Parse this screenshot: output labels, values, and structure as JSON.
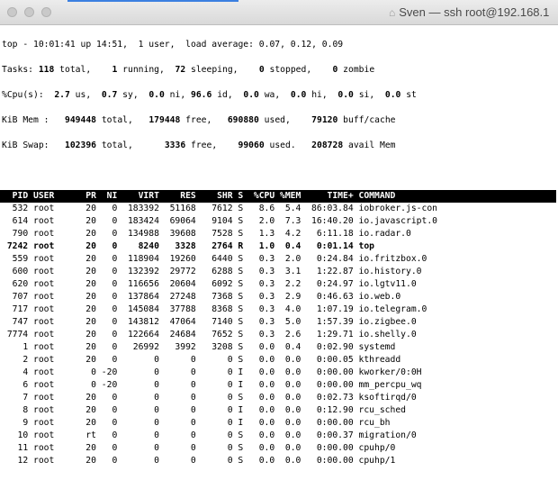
{
  "window": {
    "title": "Sven — ssh root@192.168.1"
  },
  "summary": {
    "line1": "top - 10:01:41 up 14:51,  1 user,  load average: 0.07, 0.12, 0.09",
    "tasks": {
      "label": "Tasks:",
      "total": "118",
      "running": "1",
      "sleeping": "72",
      "stopped": "0",
      "zombie": "0"
    },
    "cpu": {
      "label": "%Cpu(s):",
      "us": "2.7",
      "sy": "0.7",
      "ni": "0.0",
      "id": "96.6",
      "wa": "0.0",
      "hi": "0.0",
      "si": "0.0",
      "st": "0.0"
    },
    "mem": {
      "label": "KiB Mem :",
      "total": "949448",
      "free": "179448",
      "used": "690880",
      "buff": "79120"
    },
    "swap": {
      "label": "KiB Swap:",
      "total": "102396",
      "free": "3336",
      "used": "99060",
      "avail": "208728"
    }
  },
  "columns": [
    "PID",
    "USER",
    "PR",
    "NI",
    "VIRT",
    "RES",
    "SHR",
    "S",
    "%CPU",
    "%MEM",
    "TIME+",
    "COMMAND"
  ],
  "processes": [
    [
      "532",
      "root",
      "20",
      "0",
      "183392",
      "51168",
      "7612",
      "S",
      "8.6",
      "5.4",
      "86:03.84",
      "iobroker.js-con"
    ],
    [
      "614",
      "root",
      "20",
      "0",
      "183424",
      "69064",
      "9104",
      "S",
      "2.0",
      "7.3",
      "16:40.20",
      "io.javascript.0"
    ],
    [
      "790",
      "root",
      "20",
      "0",
      "134988",
      "39608",
      "7528",
      "S",
      "1.3",
      "4.2",
      "6:11.18",
      "io.radar.0"
    ],
    [
      "7242",
      "root",
      "20",
      "0",
      "8240",
      "3328",
      "2764",
      "R",
      "1.0",
      "0.4",
      "0:01.14",
      "top"
    ],
    [
      "559",
      "root",
      "20",
      "0",
      "118904",
      "19260",
      "6440",
      "S",
      "0.3",
      "2.0",
      "0:24.84",
      "io.fritzbox.0"
    ],
    [
      "600",
      "root",
      "20",
      "0",
      "132392",
      "29772",
      "6288",
      "S",
      "0.3",
      "3.1",
      "1:22.87",
      "io.history.0"
    ],
    [
      "620",
      "root",
      "20",
      "0",
      "116656",
      "20604",
      "6092",
      "S",
      "0.3",
      "2.2",
      "0:24.97",
      "io.lgtv11.0"
    ],
    [
      "707",
      "root",
      "20",
      "0",
      "137864",
      "27248",
      "7368",
      "S",
      "0.3",
      "2.9",
      "0:46.63",
      "io.web.0"
    ],
    [
      "717",
      "root",
      "20",
      "0",
      "145084",
      "37788",
      "8368",
      "S",
      "0.3",
      "4.0",
      "1:07.19",
      "io.telegram.0"
    ],
    [
      "747",
      "root",
      "20",
      "0",
      "143812",
      "47064",
      "7140",
      "S",
      "0.3",
      "5.0",
      "1:57.39",
      "io.zigbee.0"
    ],
    [
      "7774",
      "root",
      "20",
      "0",
      "122664",
      "24684",
      "7652",
      "S",
      "0.3",
      "2.6",
      "1:29.71",
      "io.shelly.0"
    ],
    [
      "1",
      "root",
      "20",
      "0",
      "26992",
      "3992",
      "3208",
      "S",
      "0.0",
      "0.4",
      "0:02.90",
      "systemd"
    ],
    [
      "2",
      "root",
      "20",
      "0",
      "0",
      "0",
      "0",
      "S",
      "0.0",
      "0.0",
      "0:00.05",
      "kthreadd"
    ],
    [
      "4",
      "root",
      "0",
      "-20",
      "0",
      "0",
      "0",
      "I",
      "0.0",
      "0.0",
      "0:00.00",
      "kworker/0:0H"
    ],
    [
      "6",
      "root",
      "0",
      "-20",
      "0",
      "0",
      "0",
      "I",
      "0.0",
      "0.0",
      "0:00.00",
      "mm_percpu_wq"
    ],
    [
      "7",
      "root",
      "20",
      "0",
      "0",
      "0",
      "0",
      "S",
      "0.0",
      "0.0",
      "0:02.73",
      "ksoftirqd/0"
    ],
    [
      "8",
      "root",
      "20",
      "0",
      "0",
      "0",
      "0",
      "I",
      "0.0",
      "0.0",
      "0:12.90",
      "rcu_sched"
    ],
    [
      "9",
      "root",
      "20",
      "0",
      "0",
      "0",
      "0",
      "I",
      "0.0",
      "0.0",
      "0:00.00",
      "rcu_bh"
    ],
    [
      "10",
      "root",
      "rt",
      "0",
      "0",
      "0",
      "0",
      "S",
      "0.0",
      "0.0",
      "0:00.37",
      "migration/0"
    ],
    [
      "11",
      "root",
      "20",
      "0",
      "0",
      "0",
      "0",
      "S",
      "0.0",
      "0.0",
      "0:00.00",
      "cpuhp/0"
    ],
    [
      "12",
      "root",
      "20",
      "0",
      "0",
      "0",
      "0",
      "S",
      "0.0",
      "0.0",
      "0:00.00",
      "cpuhp/1"
    ]
  ]
}
